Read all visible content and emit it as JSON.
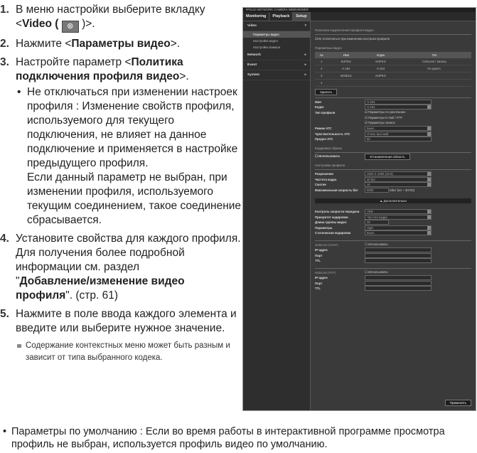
{
  "steps": [
    {
      "num": "1.",
      "pre": "В меню настройки выберите вкладку",
      "line2_pre": "<",
      "line2_b": "Video (",
      "line2_icon": "⊛",
      "line2_post": ")>."
    },
    {
      "num": "2.",
      "pre": "Нажмите <",
      "b": "Параметры видео",
      "post": ">."
    },
    {
      "num": "3.",
      "pre": "Настройте параметр <",
      "b": "Политика подключения профиля видео",
      "post": ">."
    },
    {
      "num": "4.",
      "text": "Установите свойства для каждого профиля.",
      "sub1": "Для получения более подробной информации см. раздел",
      "q": "\"",
      "b": "Добавление/изменение видео профиля",
      "post": "\". (стр. 61)"
    },
    {
      "num": "5.",
      "text": "Нажмите в поле ввода каждого элемента и введите или выберите нужное значение."
    }
  ],
  "step3_bullet": "Не отключаться при изменении настроек профиля : Изменение свойств профиля, используемого для текущего подключения, не влияет на данное подключение и применяется в настройке предыдущего профиля.",
  "step3_bullet_p2": "Если данный параметр не выбран, при изменении профиля, используемого текущим соединением, такое соединение сбрасывается.",
  "step5_note": "Содержание контекстных меню может быть разным и зависит от типа выбранного кодека.",
  "bottom_bullet": "Параметры по умолчанию : Если во время работы в интерактивной программе просмотра профиль не выбран, используется профиль видео по умолчанию.",
  "ss": {
    "title": "iPOLiS NETWORK CAMERA WEBVIEWER",
    "tabs": [
      "Monitoring",
      "Playback",
      "Setup"
    ],
    "side": [
      {
        "label": "Video",
        "subs": [
          "Параметры видео",
          "Настройка видео",
          "Настройка Камера"
        ]
      },
      {
        "label": "Network",
        "subs": []
      },
      {
        "label": "Event",
        "subs": []
      },
      {
        "label": "System",
        "subs": []
      }
    ],
    "policy_hdr": "Политика подключения профиля видео",
    "policy_chk": "Не отключаться при изменении настроек профиля",
    "video_hdr": "Параметры видео",
    "cols": [
      "№",
      "Имя",
      "Кодек",
      "Тип"
    ],
    "rows": [
      [
        "1",
        "MJPEG",
        "MJPEG",
        "События / Запись"
      ],
      [
        "2",
        "H.264",
        "H.264",
        "По умолч."
      ],
      [
        "3",
        "MOBILE",
        "MJPEG",
        ""
      ],
      [
        "4",
        "",
        "",
        ""
      ]
    ],
    "delete": "Удалить",
    "fields": [
      [
        "Имя",
        "H.264"
      ],
      [
        "Кодек",
        "H.264"
      ],
      [
        "Тип профиля",
        ""
      ],
      [
        "Режим ATC",
        "Выкл."
      ],
      [
        "Чувствительность ATC",
        "Очень высокий"
      ],
      [
        "Предел ATC",
        "50"
      ]
    ],
    "types": [
      "Параметры по умолчанию",
      "Параметры E-mail / FTP",
      "Параметры записи"
    ],
    "crop_hdr": "Кодировка обреза",
    "crop_use": "Использовать",
    "crop_btn": "Установленная область",
    "prof_hdr": "Настройки профиля",
    "prof": [
      [
        "Разрешение",
        "1920 X 1080 (16:9)"
      ],
      [
        "Частота кадра",
        "30 fps"
      ],
      [
        "Сжатие",
        "10"
      ],
      [
        "Максимальная скорость бит",
        "6000"
      ]
    ],
    "prof_unit": "Кбит (64 ~ 30720)",
    "adv": "Дополнительно",
    "adv_rows": [
      [
        "Контроль скорости передачи",
        "VBR"
      ],
      [
        "Приоритет кодировки",
        "Частота кадра"
      ],
      [
        "Длина группы видео",
        "30"
      ],
      [
        "Параметры",
        "High"
      ],
      [
        "Статическая кодировка",
        "Выкл."
      ]
    ],
    "mc1": "Multicast (SVNP)",
    "mc2": "Multicast (RTP)",
    "mc_use": "Использовать",
    "mc_rows": [
      "IP-адрес",
      "Порт",
      "TTL"
    ],
    "apply": "Применить"
  }
}
